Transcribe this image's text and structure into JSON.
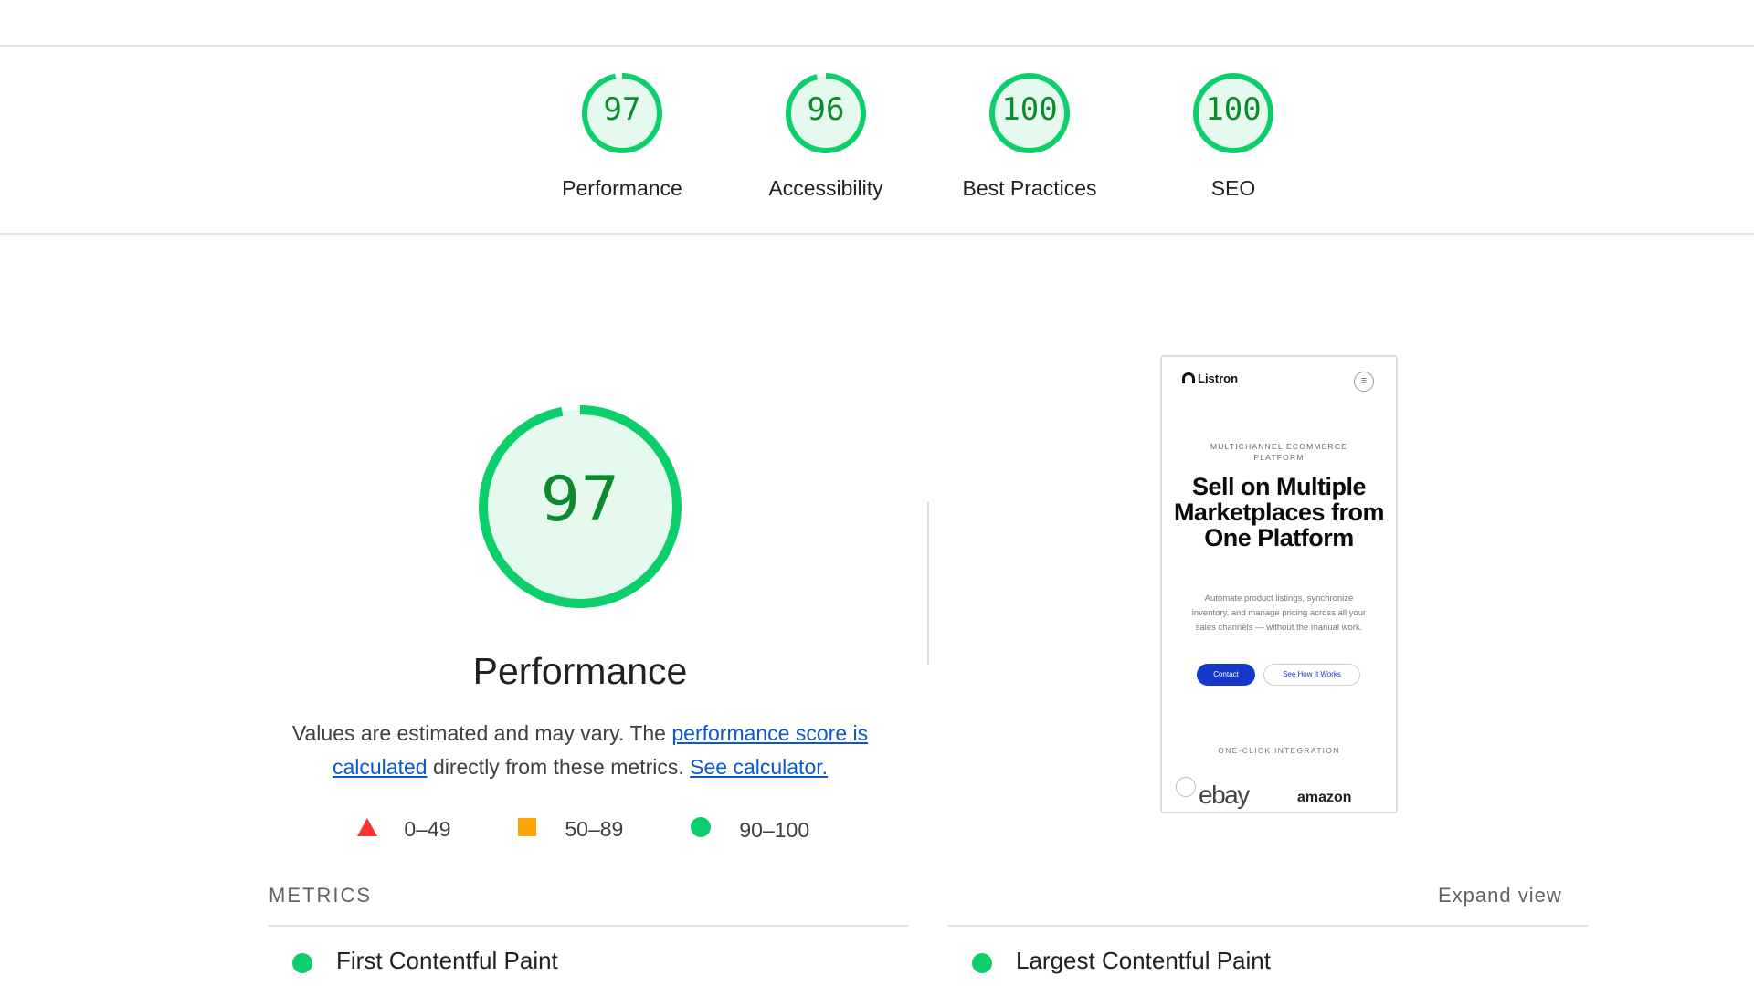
{
  "colors": {
    "pass": "#0cce6b",
    "pass_text": "#0b8a2e",
    "average": "#ffa400",
    "fail": "#ff3333",
    "link": "#0b57d0"
  },
  "scores": [
    {
      "value": "97",
      "label": "Performance",
      "fraction": 0.97
    },
    {
      "value": "96",
      "label": "Accessibility",
      "fraction": 0.96
    },
    {
      "value": "100",
      "label": "Best Practices",
      "fraction": 1.0
    },
    {
      "value": "100",
      "label": "SEO",
      "fraction": 1.0
    }
  ],
  "performance": {
    "score": "97",
    "score_fraction": 0.97,
    "title": "Performance",
    "desc_prefix": "Values are estimated and may vary. The ",
    "desc_link1": "performance score is calculated",
    "desc_mid": " directly from these metrics. ",
    "desc_link2": "See calculator."
  },
  "legend": {
    "fail": "0–49",
    "average": "50–89",
    "pass": "90–100"
  },
  "screenshot": {
    "brand": "Listron",
    "kicker": "MULTICHANNEL ECOMMERCE PLATFORM",
    "headline": "Sell on Multiple Marketplaces from One Platform",
    "sub": "Automate product listings, synchronize inventory, and manage pricing across all your sales channels — without the manual work.",
    "primary_button": "Contact",
    "secondary_button": "See How It Works",
    "integration_label": "ONE-CLICK INTEGRATION",
    "logo1": "ebay",
    "logo2": "amazon"
  },
  "metrics": {
    "title": "METRICS",
    "expand": "Expand view",
    "items": [
      {
        "label": "First Contentful Paint",
        "status": "pass"
      },
      {
        "label": "Largest Contentful Paint",
        "status": "pass"
      }
    ]
  }
}
